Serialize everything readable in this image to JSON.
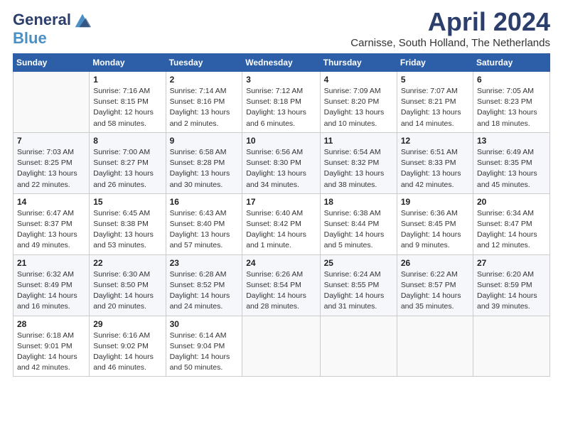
{
  "logo": {
    "line1": "General",
    "line2": "Blue"
  },
  "title": "April 2024",
  "subtitle": "Carnisse, South Holland, The Netherlands",
  "weekdays": [
    "Sunday",
    "Monday",
    "Tuesday",
    "Wednesday",
    "Thursday",
    "Friday",
    "Saturday"
  ],
  "weeks": [
    [
      {
        "day": "",
        "info": ""
      },
      {
        "day": "1",
        "info": "Sunrise: 7:16 AM\nSunset: 8:15 PM\nDaylight: 12 hours\nand 58 minutes."
      },
      {
        "day": "2",
        "info": "Sunrise: 7:14 AM\nSunset: 8:16 PM\nDaylight: 13 hours\nand 2 minutes."
      },
      {
        "day": "3",
        "info": "Sunrise: 7:12 AM\nSunset: 8:18 PM\nDaylight: 13 hours\nand 6 minutes."
      },
      {
        "day": "4",
        "info": "Sunrise: 7:09 AM\nSunset: 8:20 PM\nDaylight: 13 hours\nand 10 minutes."
      },
      {
        "day": "5",
        "info": "Sunrise: 7:07 AM\nSunset: 8:21 PM\nDaylight: 13 hours\nand 14 minutes."
      },
      {
        "day": "6",
        "info": "Sunrise: 7:05 AM\nSunset: 8:23 PM\nDaylight: 13 hours\nand 18 minutes."
      }
    ],
    [
      {
        "day": "7",
        "info": "Sunrise: 7:03 AM\nSunset: 8:25 PM\nDaylight: 13 hours\nand 22 minutes."
      },
      {
        "day": "8",
        "info": "Sunrise: 7:00 AM\nSunset: 8:27 PM\nDaylight: 13 hours\nand 26 minutes."
      },
      {
        "day": "9",
        "info": "Sunrise: 6:58 AM\nSunset: 8:28 PM\nDaylight: 13 hours\nand 30 minutes."
      },
      {
        "day": "10",
        "info": "Sunrise: 6:56 AM\nSunset: 8:30 PM\nDaylight: 13 hours\nand 34 minutes."
      },
      {
        "day": "11",
        "info": "Sunrise: 6:54 AM\nSunset: 8:32 PM\nDaylight: 13 hours\nand 38 minutes."
      },
      {
        "day": "12",
        "info": "Sunrise: 6:51 AM\nSunset: 8:33 PM\nDaylight: 13 hours\nand 42 minutes."
      },
      {
        "day": "13",
        "info": "Sunrise: 6:49 AM\nSunset: 8:35 PM\nDaylight: 13 hours\nand 45 minutes."
      }
    ],
    [
      {
        "day": "14",
        "info": "Sunrise: 6:47 AM\nSunset: 8:37 PM\nDaylight: 13 hours\nand 49 minutes."
      },
      {
        "day": "15",
        "info": "Sunrise: 6:45 AM\nSunset: 8:38 PM\nDaylight: 13 hours\nand 53 minutes."
      },
      {
        "day": "16",
        "info": "Sunrise: 6:43 AM\nSunset: 8:40 PM\nDaylight: 13 hours\nand 57 minutes."
      },
      {
        "day": "17",
        "info": "Sunrise: 6:40 AM\nSunset: 8:42 PM\nDaylight: 14 hours\nand 1 minute."
      },
      {
        "day": "18",
        "info": "Sunrise: 6:38 AM\nSunset: 8:44 PM\nDaylight: 14 hours\nand 5 minutes."
      },
      {
        "day": "19",
        "info": "Sunrise: 6:36 AM\nSunset: 8:45 PM\nDaylight: 14 hours\nand 9 minutes."
      },
      {
        "day": "20",
        "info": "Sunrise: 6:34 AM\nSunset: 8:47 PM\nDaylight: 14 hours\nand 12 minutes."
      }
    ],
    [
      {
        "day": "21",
        "info": "Sunrise: 6:32 AM\nSunset: 8:49 PM\nDaylight: 14 hours\nand 16 minutes."
      },
      {
        "day": "22",
        "info": "Sunrise: 6:30 AM\nSunset: 8:50 PM\nDaylight: 14 hours\nand 20 minutes."
      },
      {
        "day": "23",
        "info": "Sunrise: 6:28 AM\nSunset: 8:52 PM\nDaylight: 14 hours\nand 24 minutes."
      },
      {
        "day": "24",
        "info": "Sunrise: 6:26 AM\nSunset: 8:54 PM\nDaylight: 14 hours\nand 28 minutes."
      },
      {
        "day": "25",
        "info": "Sunrise: 6:24 AM\nSunset: 8:55 PM\nDaylight: 14 hours\nand 31 minutes."
      },
      {
        "day": "26",
        "info": "Sunrise: 6:22 AM\nSunset: 8:57 PM\nDaylight: 14 hours\nand 35 minutes."
      },
      {
        "day": "27",
        "info": "Sunrise: 6:20 AM\nSunset: 8:59 PM\nDaylight: 14 hours\nand 39 minutes."
      }
    ],
    [
      {
        "day": "28",
        "info": "Sunrise: 6:18 AM\nSunset: 9:01 PM\nDaylight: 14 hours\nand 42 minutes."
      },
      {
        "day": "29",
        "info": "Sunrise: 6:16 AM\nSunset: 9:02 PM\nDaylight: 14 hours\nand 46 minutes."
      },
      {
        "day": "30",
        "info": "Sunrise: 6:14 AM\nSunset: 9:04 PM\nDaylight: 14 hours\nand 50 minutes."
      },
      {
        "day": "",
        "info": ""
      },
      {
        "day": "",
        "info": ""
      },
      {
        "day": "",
        "info": ""
      },
      {
        "day": "",
        "info": ""
      }
    ]
  ]
}
